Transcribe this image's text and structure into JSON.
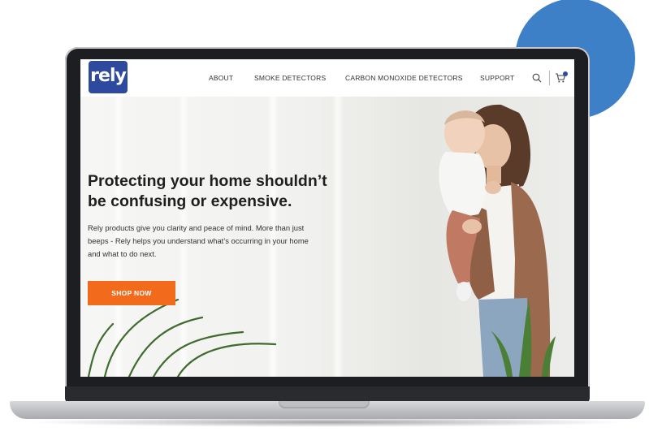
{
  "brand": {
    "logo_text": "rely",
    "primary_color": "#2e4a9e",
    "accent_color": "#f26a1b",
    "decor_circle_color": "#3d80c8"
  },
  "nav": {
    "items": [
      {
        "label": "ABOUT"
      },
      {
        "label": "SMOKE DETECTORS"
      },
      {
        "label": "CARBON MONOXIDE DETECTORS"
      },
      {
        "label": "SUPPORT"
      }
    ],
    "icons": [
      "search-icon",
      "cart-icon"
    ]
  },
  "hero": {
    "title": "Protecting your home shouldn’t be confusing or expensive.",
    "body": "Rely products give you clarity and peace of mind. More than just beeps - Rely helps you understand what’s occurring in your home and what to do next.",
    "cta_label": "SHOP NOW"
  }
}
